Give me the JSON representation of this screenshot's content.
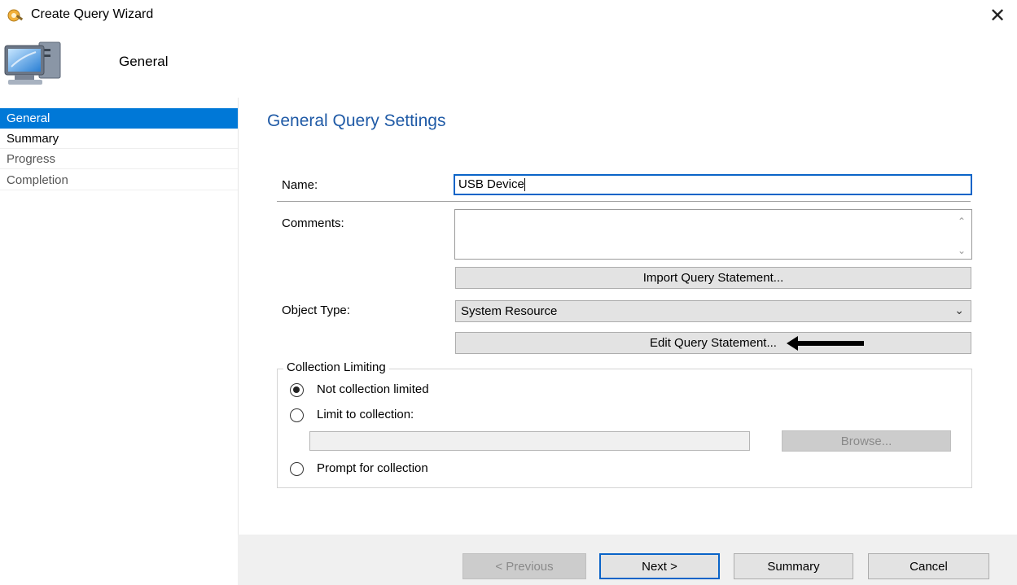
{
  "window": {
    "title": "Create Query Wizard",
    "close_glyph": "✕"
  },
  "header": {
    "title": "General"
  },
  "nav": {
    "items": [
      {
        "label": "General",
        "state": "active"
      },
      {
        "label": "Summary",
        "state": "normal"
      },
      {
        "label": "Progress",
        "state": "disabled"
      },
      {
        "label": "Completion",
        "state": "disabled"
      }
    ]
  },
  "main": {
    "section_title": "General Query Settings",
    "name_label": "Name:",
    "name_value": "USB Device",
    "comments_label": "Comments:",
    "comments_value": "",
    "import_button": "Import Query Statement...",
    "object_type_label": "Object Type:",
    "object_type_value": "System Resource",
    "edit_button": "Edit Query Statement...",
    "collection": {
      "legend": "Collection Limiting",
      "not_limited": "Not collection limited",
      "limit_to": "Limit to collection:",
      "collection_value": "",
      "browse_button": "Browse...",
      "prompt": "Prompt for collection",
      "selected": "not_limited"
    }
  },
  "footer": {
    "previous": "< Previous",
    "next": "Next >",
    "summary": "Summary",
    "cancel": "Cancel"
  },
  "colors": {
    "accent": "#0078d7",
    "section_title": "#1f5aa6",
    "focus_border": "#0a64c8"
  },
  "icons": [
    "wizard-app-icon",
    "computer-icon",
    "close-icon",
    "scroll-up-icon",
    "scroll-down-icon",
    "dropdown-chevron-icon",
    "arrow-pointer-icon"
  ]
}
